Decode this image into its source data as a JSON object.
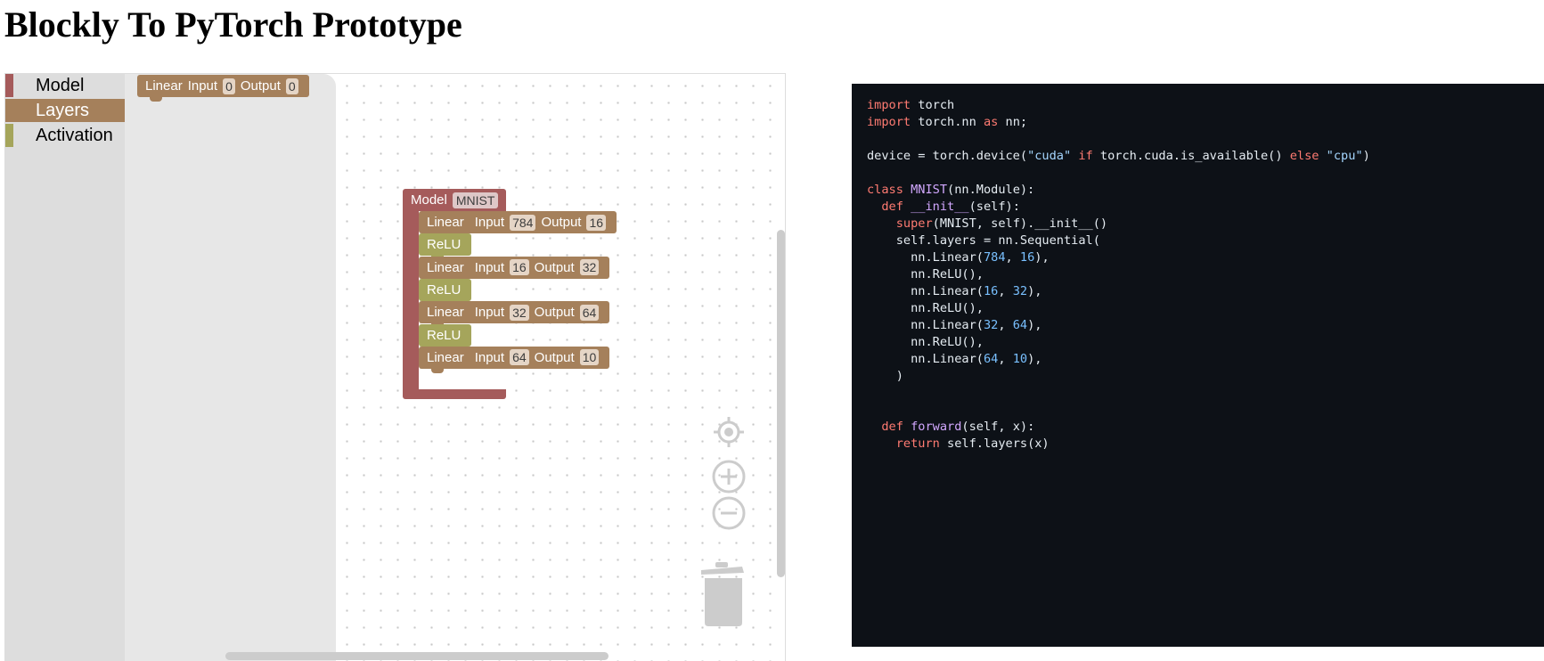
{
  "page": {
    "title": "Blockly To PyTorch Prototype"
  },
  "toolbox": {
    "categories": [
      {
        "label": "Model",
        "color": "#a55b5b",
        "selected": false
      },
      {
        "label": "Layers",
        "color": "#a5805b",
        "selected": true
      },
      {
        "label": "Activation",
        "color": "#a5a55b",
        "selected": false
      }
    ]
  },
  "flyout": {
    "linear_block": {
      "label": "Linear",
      "input_label": "Input",
      "input_value": "0",
      "output_label": "Output",
      "output_value": "0"
    }
  },
  "workspace": {
    "model": {
      "label": "Model",
      "name": "MNIST",
      "layers": [
        {
          "type": "Linear",
          "input_label": "Input",
          "input": "784",
          "output_label": "Output",
          "output": "16"
        },
        {
          "type": "ReLU"
        },
        {
          "type": "Linear",
          "input_label": "Input",
          "input": "16",
          "output_label": "Output",
          "output": "32"
        },
        {
          "type": "ReLU"
        },
        {
          "type": "Linear",
          "input_label": "Input",
          "input": "32",
          "output_label": "Output",
          "output": "64"
        },
        {
          "type": "ReLU"
        },
        {
          "type": "Linear",
          "input_label": "Input",
          "input": "64",
          "output_label": "Output",
          "output": "10"
        }
      ]
    },
    "controls": [
      "recenter-icon",
      "zoom-in-icon",
      "zoom-out-icon",
      "trash-icon"
    ]
  },
  "code": {
    "lines": [
      [
        [
          "kw",
          "import"
        ],
        [
          "t",
          " torch"
        ]
      ],
      [
        [
          "kw",
          "import"
        ],
        [
          "t",
          " torch.nn "
        ],
        [
          "kw",
          "as"
        ],
        [
          "t",
          " nn;"
        ]
      ],
      [],
      [
        [
          "t",
          "device = torch.device("
        ],
        [
          "str",
          "\"cuda\""
        ],
        [
          "t",
          " "
        ],
        [
          "kw",
          "if"
        ],
        [
          "t",
          " torch.cuda.is_available() "
        ],
        [
          "kw",
          "else"
        ],
        [
          "t",
          " "
        ],
        [
          "str",
          "\"cpu\""
        ],
        [
          "t",
          ")"
        ]
      ],
      [],
      [
        [
          "kw",
          "class"
        ],
        [
          "t",
          " "
        ],
        [
          "fn",
          "MNIST"
        ],
        [
          "t",
          "(nn.Module):"
        ]
      ],
      [
        [
          "t",
          "  "
        ],
        [
          "kw",
          "def"
        ],
        [
          "t",
          " "
        ],
        [
          "fn",
          "__init__"
        ],
        [
          "t",
          "(self):"
        ]
      ],
      [
        [
          "t",
          "    "
        ],
        [
          "kw",
          "super"
        ],
        [
          "t",
          "(MNIST, self).__init__()"
        ]
      ],
      [
        [
          "t",
          "    self.layers = nn.Sequential("
        ]
      ],
      [
        [
          "t",
          "      nn.Linear("
        ],
        [
          "num",
          "784"
        ],
        [
          "t",
          ", "
        ],
        [
          "num",
          "16"
        ],
        [
          "t",
          "),"
        ]
      ],
      [
        [
          "t",
          "      nn.ReLU(),"
        ]
      ],
      [
        [
          "t",
          "      nn.Linear("
        ],
        [
          "num",
          "16"
        ],
        [
          "t",
          ", "
        ],
        [
          "num",
          "32"
        ],
        [
          "t",
          "),"
        ]
      ],
      [
        [
          "t",
          "      nn.ReLU(),"
        ]
      ],
      [
        [
          "t",
          "      nn.Linear("
        ],
        [
          "num",
          "32"
        ],
        [
          "t",
          ", "
        ],
        [
          "num",
          "64"
        ],
        [
          "t",
          "),"
        ]
      ],
      [
        [
          "t",
          "      nn.ReLU(),"
        ]
      ],
      [
        [
          "t",
          "      nn.Linear("
        ],
        [
          "num",
          "64"
        ],
        [
          "t",
          ", "
        ],
        [
          "num",
          "10"
        ],
        [
          "t",
          "),"
        ]
      ],
      [
        [
          "t",
          "    )"
        ]
      ],
      [],
      [],
      [
        [
          "t",
          "  "
        ],
        [
          "kw",
          "def"
        ],
        [
          "t",
          " "
        ],
        [
          "fn",
          "forward"
        ],
        [
          "t",
          "(self, x):"
        ]
      ],
      [
        [
          "t",
          "    "
        ],
        [
          "kw",
          "return"
        ],
        [
          "t",
          " self.layers(x)"
        ]
      ]
    ]
  }
}
